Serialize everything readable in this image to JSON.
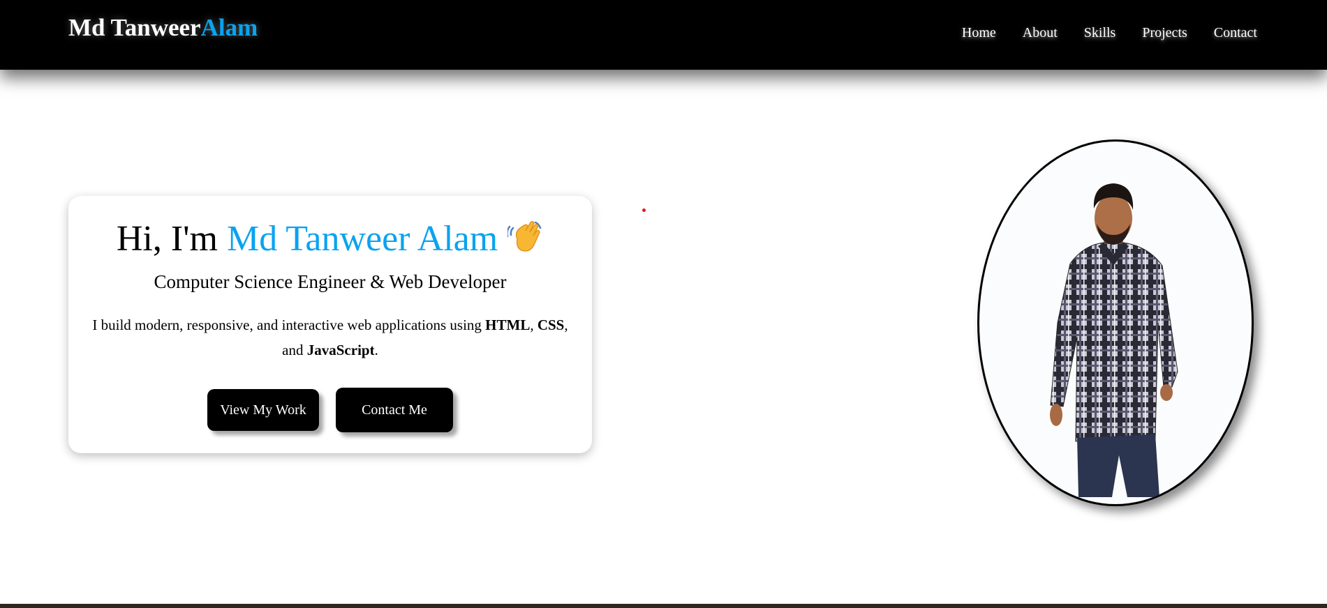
{
  "header": {
    "logo_first": "Md Tanweer",
    "logo_accent": "Alam",
    "nav": [
      "Home",
      "About",
      "Skills",
      "Projects",
      "Contact"
    ]
  },
  "hero": {
    "greeting_prefix": "Hi, I'm",
    "greeting_name": "Md Tanweer Alam",
    "wave_icon": "waving-hand-emoji",
    "subtitle": "Computer Science Engineer & Web Developer",
    "desc_part1": "I build modern, responsive, and interactive web applications using",
    "desc_html": "HTML",
    "desc_sep1": ",",
    "desc_css": "CSS",
    "desc_sep2": ", and",
    "desc_js": "JavaScript",
    "desc_end": ".",
    "btn_work": "View My Work",
    "btn_contact": "Contact Me"
  },
  "profile": {
    "photo": "profile-photo"
  },
  "colors": {
    "accent": "#0aa3ef",
    "header_bg": "#000000",
    "button_bg": "#000000"
  }
}
